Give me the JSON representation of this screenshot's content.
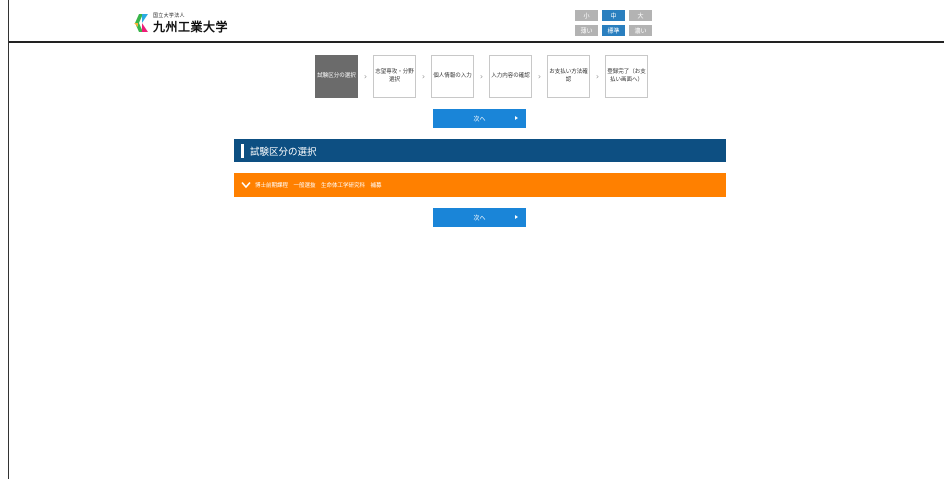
{
  "header": {
    "org_type": "国立大学法人",
    "university_name": "九州工業大学",
    "font_size": {
      "small": "小",
      "medium": "中",
      "large": "大"
    },
    "contrast": {
      "light": "薄い",
      "standard": "標準",
      "dark": "濃い"
    }
  },
  "steps": [
    {
      "label": "試験区分の選択"
    },
    {
      "label": "志望専攻・分野選択"
    },
    {
      "label": "個人情報の入力"
    },
    {
      "label": "入力内容の確認"
    },
    {
      "label": "お支払い方法確認"
    },
    {
      "label": "登録完了（お支払い画面へ）"
    }
  ],
  "buttons": {
    "next_label": "次へ"
  },
  "section": {
    "title": "試験区分の選択"
  },
  "accordion": {
    "label": "博士前期課程　一般選抜　生命体工学研究科　補募"
  },
  "colors": {
    "accent": "#1a85d8",
    "section": "#0d4f82",
    "accordion": "#ff8000",
    "active_step": "#6b6b6b"
  }
}
